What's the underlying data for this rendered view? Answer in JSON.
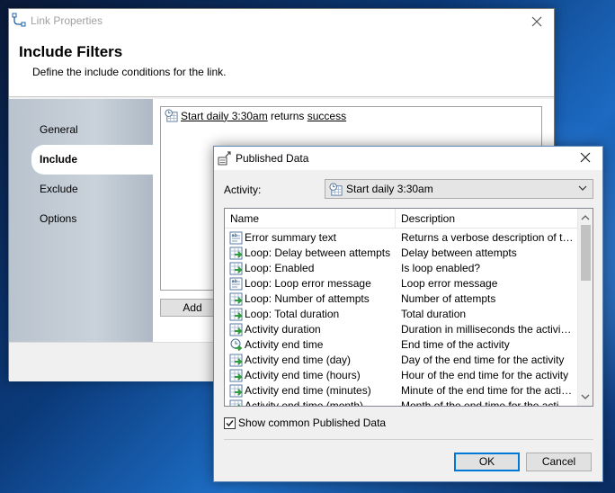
{
  "link_properties": {
    "title": "Link Properties",
    "heading": "Include Filters",
    "subheading": "Define the include conditions for the link.",
    "sidebar": [
      {
        "label": "General"
      },
      {
        "label": "Include"
      },
      {
        "label": "Exclude"
      },
      {
        "label": "Options"
      }
    ],
    "filter": {
      "activity": "Start daily 3:30am",
      "verb": " returns ",
      "state": "success"
    },
    "add_label": "Add"
  },
  "published_data": {
    "title": "Published Data",
    "activity_label": "Activity:",
    "activity_value": "Start daily 3:30am",
    "columns": {
      "name": "Name",
      "description": "Description"
    },
    "rows": [
      {
        "name": "Error summary text",
        "description": "Returns a verbose description of the...",
        "icon": "text-data-icon"
      },
      {
        "name": "Loop: Delay between attempts",
        "description": "Delay between attempts",
        "icon": "number-data-icon"
      },
      {
        "name": "Loop: Enabled",
        "description": "Is loop enabled?",
        "icon": "number-data-icon"
      },
      {
        "name": "Loop: Loop error message",
        "description": "Loop error message",
        "icon": "text-data-icon"
      },
      {
        "name": "Loop: Number of attempts",
        "description": "Number of attempts",
        "icon": "number-data-icon"
      },
      {
        "name": "Loop: Total duration",
        "description": "Total duration",
        "icon": "number-data-icon"
      },
      {
        "name": "Activity duration",
        "description": "Duration in milliseconds the activity t...",
        "icon": "number-data-icon"
      },
      {
        "name": "Activity end time",
        "description": "End time of the activity",
        "icon": "clock-data-icon"
      },
      {
        "name": "Activity end time (day)",
        "description": "Day of the end time for the activity",
        "icon": "number-data-icon"
      },
      {
        "name": "Activity end time (hours)",
        "description": "Hour of the end time for the activity",
        "icon": "number-data-icon"
      },
      {
        "name": "Activity end time (minutes)",
        "description": "Minute of the end time for the activity",
        "icon": "number-data-icon"
      },
      {
        "name": "Activity end time (month)",
        "description": "Month of the end time for the activity",
        "icon": "number-data-icon"
      }
    ],
    "show_common_label": "Show common Published Data",
    "show_common_checked": true,
    "ok_label": "OK",
    "cancel_label": "Cancel"
  }
}
